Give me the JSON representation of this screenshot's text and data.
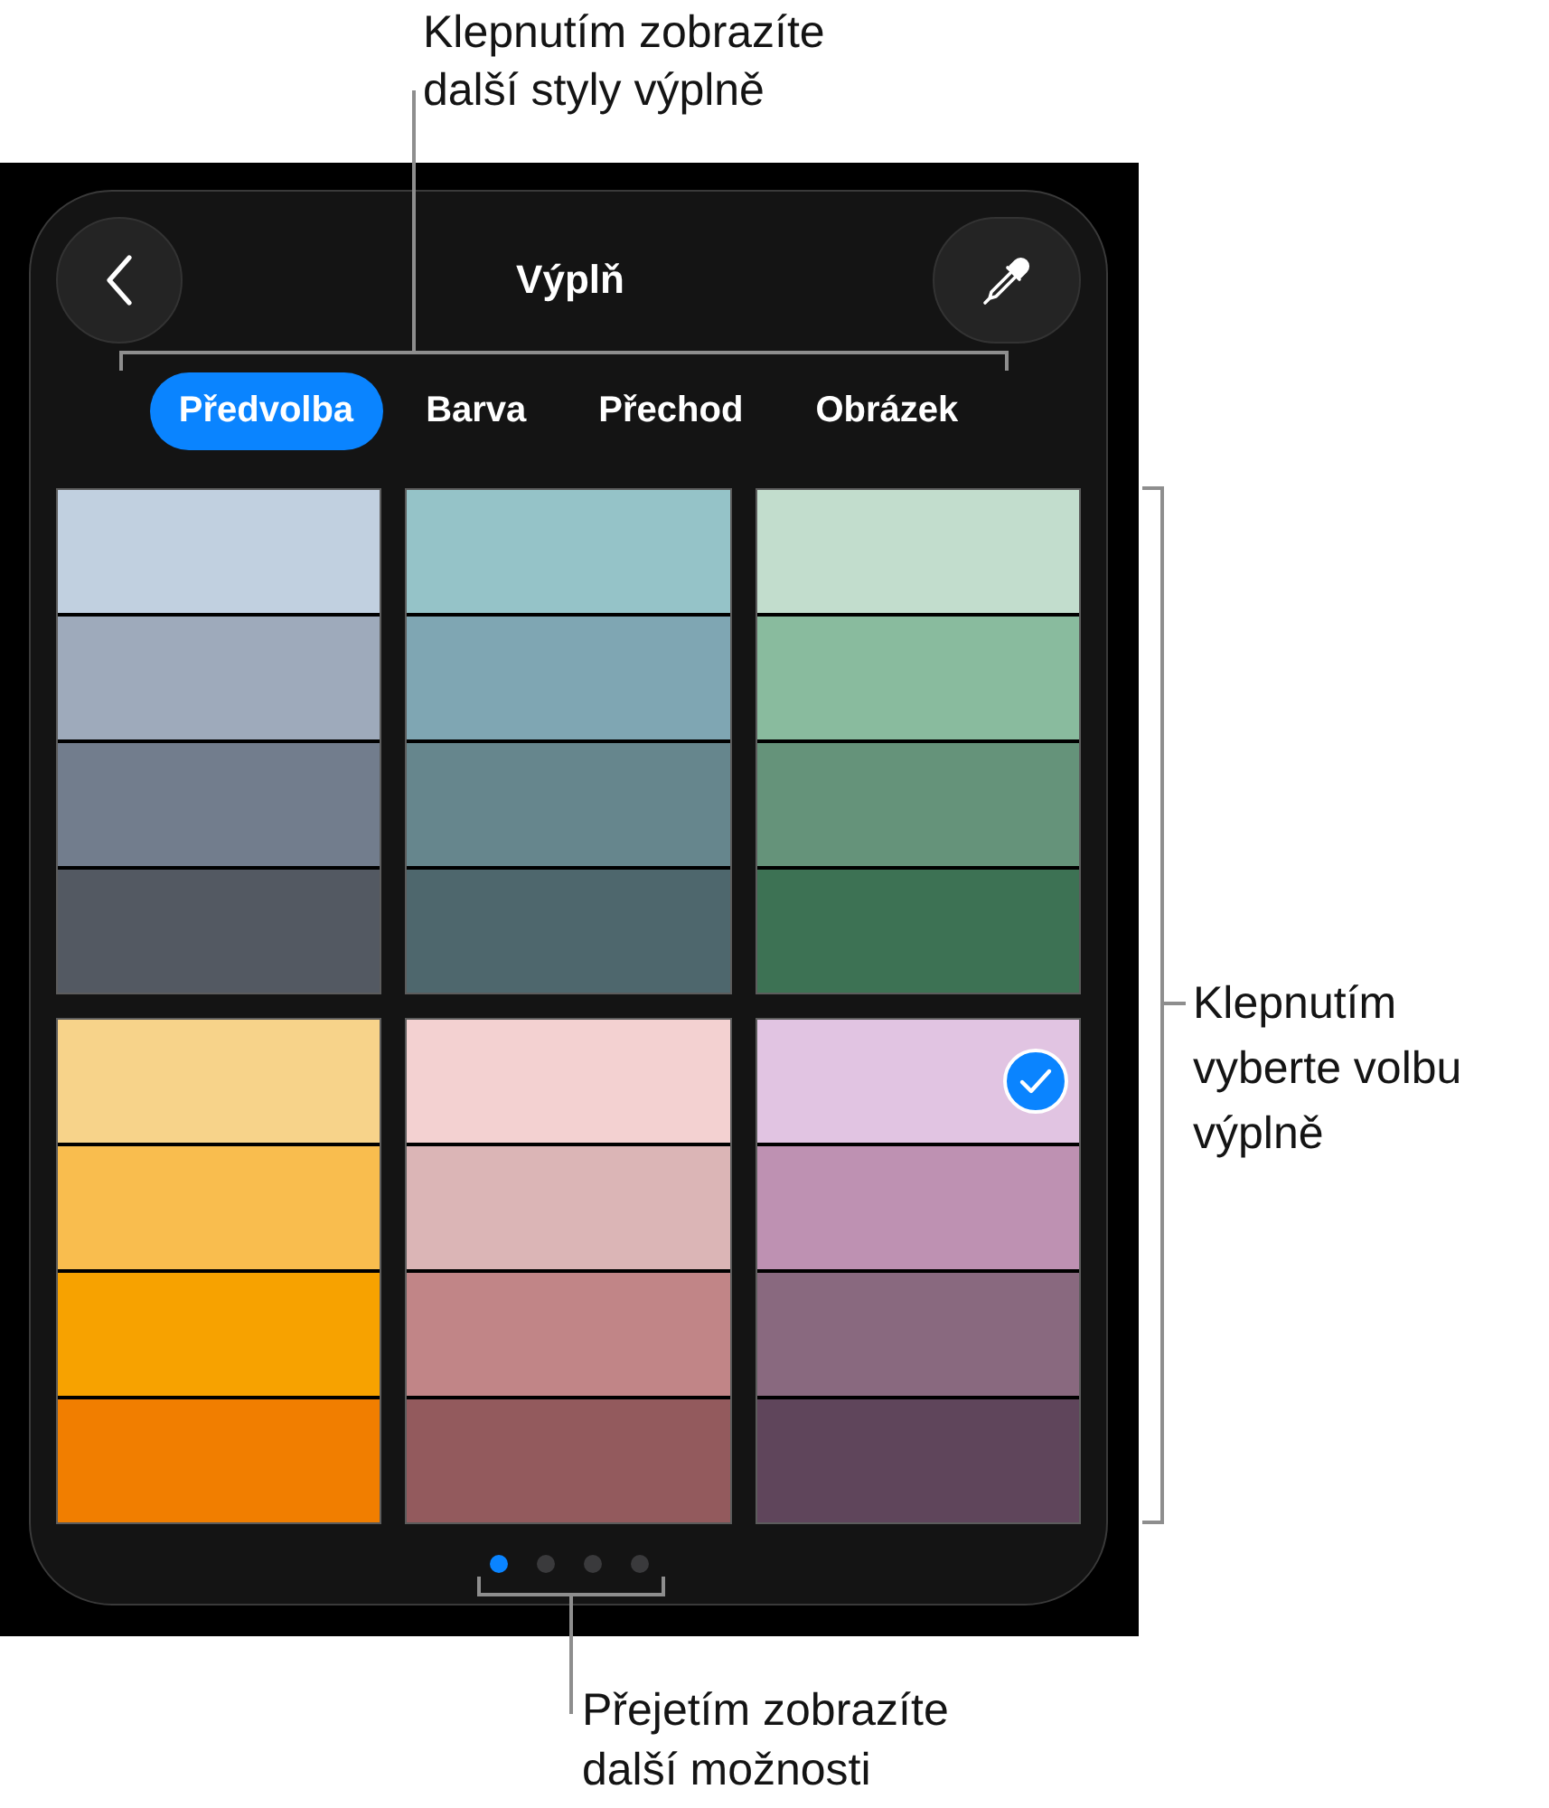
{
  "callouts": [
    {
      "lines": [
        "Klepnutím zobrazíte",
        "další styly výplně"
      ]
    },
    {
      "lines": [
        "Klepnutím",
        "vyberte volbu",
        "výplně"
      ]
    },
    {
      "lines": [
        "Přejetím zobrazíte",
        "další možnosti"
      ]
    }
  ],
  "panel": {
    "title": "Výplň"
  },
  "tabs": [
    {
      "label": "Předvolba",
      "selected": true
    },
    {
      "label": "Barva",
      "selected": false
    },
    {
      "label": "Přechod",
      "selected": false
    },
    {
      "label": "Obrázek",
      "selected": false
    }
  ],
  "swatch_rows": [
    {
      "palettes": [
        {
          "stripes": [
            {
              "color": "#c1d0e0",
              "selected": false
            },
            {
              "color": "#9eaabb",
              "selected": false
            },
            {
              "color": "#727d8d",
              "selected": false
            },
            {
              "color": "#535962",
              "selected": false
            }
          ]
        },
        {
          "stripes": [
            {
              "color": "#95c3c8",
              "selected": false
            },
            {
              "color": "#7fa6b3",
              "selected": false
            },
            {
              "color": "#66868d",
              "selected": false
            },
            {
              "color": "#4e676d",
              "selected": false
            }
          ]
        },
        {
          "stripes": [
            {
              "color": "#c2ddcd",
              "selected": false
            },
            {
              "color": "#89bb9e",
              "selected": false
            },
            {
              "color": "#65937a",
              "selected": false
            },
            {
              "color": "#3d7254",
              "selected": false
            }
          ]
        }
      ]
    },
    {
      "palettes": [
        {
          "stripes": [
            {
              "color": "#f7d38a",
              "selected": false
            },
            {
              "color": "#f9bd4e",
              "selected": false
            },
            {
              "color": "#f7a200",
              "selected": false
            },
            {
              "color": "#f17e00",
              "selected": false
            }
          ]
        },
        {
          "stripes": [
            {
              "color": "#f3d1d1",
              "selected": false
            },
            {
              "color": "#dbb5b6",
              "selected": false
            },
            {
              "color": "#c18587",
              "selected": false
            },
            {
              "color": "#935a5d",
              "selected": false
            }
          ]
        },
        {
          "stripes": [
            {
              "color": "#e1c4e2",
              "selected": true
            },
            {
              "color": "#be91b2",
              "selected": false
            },
            {
              "color": "#89697f",
              "selected": false
            },
            {
              "color": "#5f455b",
              "selected": false
            }
          ]
        }
      ]
    }
  ],
  "page_dots": [
    {
      "selected": true
    },
    {
      "selected": false
    },
    {
      "selected": false
    },
    {
      "selected": false
    }
  ]
}
